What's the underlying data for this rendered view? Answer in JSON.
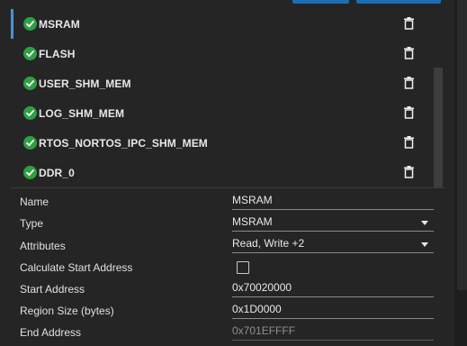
{
  "colors": {
    "accent": "#1b6fb5",
    "check_green": "#2ea043",
    "selection": "#4a8fe0",
    "background": "#252526"
  },
  "regions": [
    {
      "label": "MSRAM",
      "status_icon": "check-circle-icon",
      "action_icon": "trash-icon",
      "selected": true
    },
    {
      "label": "FLASH",
      "status_icon": "check-circle-icon",
      "action_icon": "trash-icon"
    },
    {
      "label": "USER_SHM_MEM",
      "status_icon": "check-circle-icon",
      "action_icon": "trash-icon"
    },
    {
      "label": "LOG_SHM_MEM",
      "status_icon": "check-circle-icon",
      "action_icon": "trash-icon"
    },
    {
      "label": "RTOS_NORTOS_IPC_SHM_MEM",
      "status_icon": "check-circle-icon",
      "action_icon": "trash-icon"
    },
    {
      "label": "DDR_0",
      "status_icon": "check-circle-icon",
      "action_icon": "trash-icon"
    }
  ],
  "form": {
    "name": {
      "label": "Name",
      "value": "MSRAM"
    },
    "type": {
      "label": "Type",
      "value": "MSRAM"
    },
    "attributes": {
      "label": "Attributes",
      "value": "Read, Write +2"
    },
    "calc_start": {
      "label": "Calculate Start Address",
      "checked": false
    },
    "start_address": {
      "label": "Start Address",
      "value": "0x70020000"
    },
    "region_size": {
      "label": "Region Size (bytes)",
      "value": "0x1D0000"
    },
    "end_address": {
      "label": "End Address",
      "value": "0x701EFFFF"
    }
  }
}
